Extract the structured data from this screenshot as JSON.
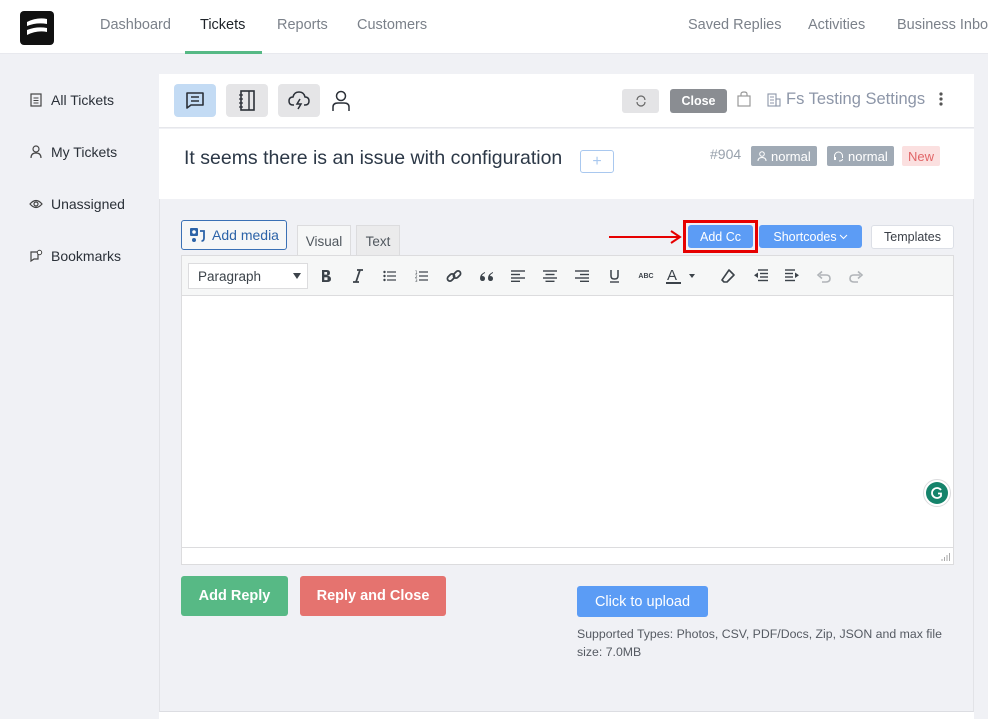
{
  "top_nav": {
    "left_items": [
      {
        "label": "Dashboard",
        "active": false
      },
      {
        "label": "Tickets",
        "active": true
      },
      {
        "label": "Reports",
        "active": false
      },
      {
        "label": "Customers",
        "active": false
      }
    ],
    "right_items": [
      {
        "label": "Saved Replies"
      },
      {
        "label": "Activities"
      },
      {
        "label": "Business Inbox"
      }
    ],
    "accent_color": "#56b985"
  },
  "sidebar": {
    "items": [
      {
        "label": "All Tickets",
        "icon": "document-icon"
      },
      {
        "label": "My Tickets",
        "icon": "user-icon"
      },
      {
        "label": "Unassigned",
        "icon": "eye-icon"
      },
      {
        "label": "Bookmarks",
        "icon": "chat-bookmark-icon"
      }
    ]
  },
  "ticket_toolbar": {
    "tabs": [
      {
        "icon": "conversation-icon",
        "active": true
      },
      {
        "icon": "notebook-icon",
        "active": false
      },
      {
        "icon": "cloud-bolt-icon",
        "active": false
      },
      {
        "icon": "user-icon",
        "active": false
      }
    ],
    "close_label": "Close",
    "mailbox_label": "Fs Testing Settings"
  },
  "ticket": {
    "title": "It seems there is an issue with configuration",
    "add_tag_label": "+",
    "id": "#904",
    "badges": [
      {
        "icon": "user-icon",
        "label": "normal"
      },
      {
        "icon": "headset-icon",
        "label": "normal"
      },
      {
        "icon": "",
        "label": "New"
      }
    ]
  },
  "composer": {
    "add_media_label": "Add media",
    "tabs": [
      {
        "label": "Visual",
        "active": true
      },
      {
        "label": "Text",
        "active": false
      }
    ],
    "add_cc_label": "Add Cc",
    "shortcodes_label": "Shortcodes",
    "templates_label": "Templates",
    "format_select": "Paragraph",
    "toolbar_tools": [
      "bold",
      "italic",
      "bullet-list",
      "numbered-list",
      "link",
      "blockquote",
      "align-left",
      "align-center",
      "align-right",
      "underline",
      "strikethrough",
      "text-color",
      "clear-formatting",
      "outdent",
      "indent",
      "undo",
      "redo"
    ],
    "body_text": "",
    "strikethrough_glyph": "ABC",
    "text_color_glyph": "A"
  },
  "actions": {
    "add_reply_label": "Add Reply",
    "reply_close_label": "Reply and Close",
    "upload_label": "Click to upload",
    "upload_note": "Supported Types: Photos, CSV, PDF/Docs, Zip, JSON and max file size: 7.0MB"
  }
}
